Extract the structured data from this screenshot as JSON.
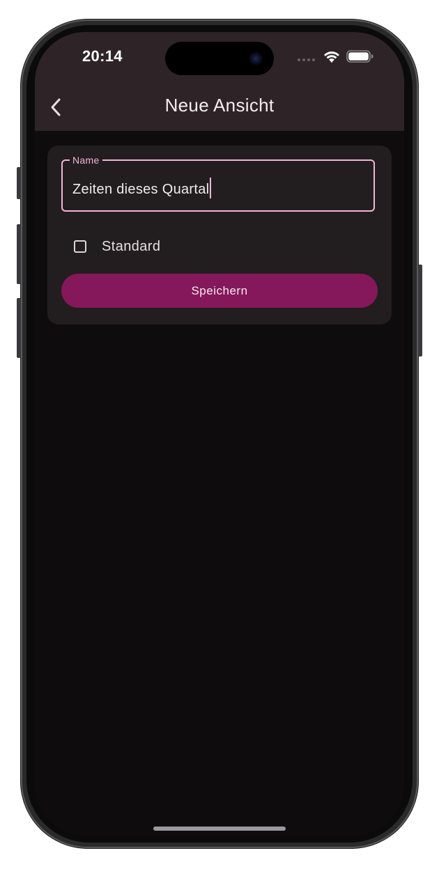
{
  "status_bar": {
    "time": "20:14"
  },
  "nav": {
    "title": "Neue Ansicht",
    "back_icon": "chevron-left-icon"
  },
  "form": {
    "name_label": "Name",
    "name_value": "Zeiten dieses Quartal",
    "checkbox_label": "Standard",
    "checkbox_checked": false,
    "save_label": "Speichern"
  },
  "colors": {
    "accent": "#85185a",
    "field_outline": "#f4b5d5",
    "app_bar": "#2e2428",
    "background": "#0f0c0d",
    "card": "#221d1f"
  }
}
